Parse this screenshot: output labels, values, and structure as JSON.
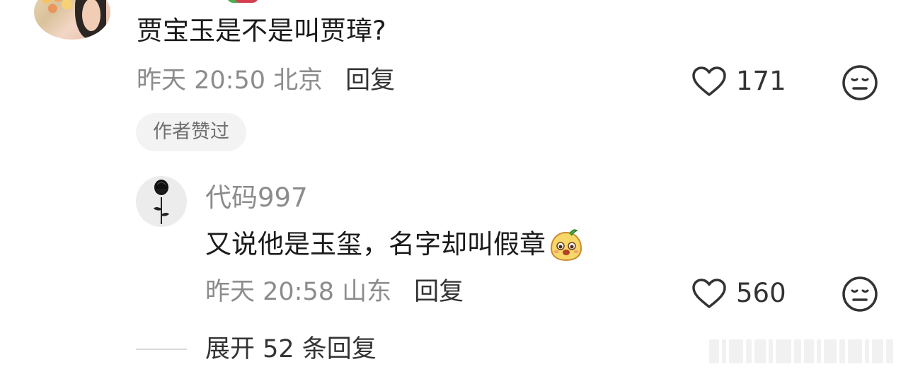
{
  "comment": {
    "text": "贾宝玉是不是叫贾璋?",
    "time_location": "昨天 20:50 北京",
    "reply_label": "回复",
    "likes": "171",
    "author_liked_badge": "作者赞过"
  },
  "reply": {
    "username": "代码997",
    "text": "又说他是玉玺，名字却叫假章",
    "time_location": "昨天 20:58 山东",
    "reply_label": "回复",
    "likes": "560"
  },
  "expand": {
    "label": "展开 52 条回复"
  },
  "icons": {
    "like": "heart-outline-icon",
    "dislike": "neutral-face-icon",
    "emoji": "cartoon-emoji-icon"
  },
  "colors": {
    "primary_text": "#1a1a1a",
    "secondary_text": "#8c8c8c",
    "badge_background": "#f3f3f3"
  }
}
